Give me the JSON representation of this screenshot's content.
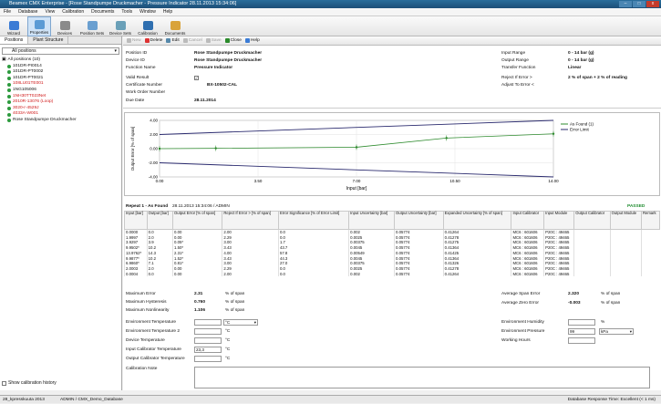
{
  "window": {
    "title": "Beamex CMX Enterprise - [Rose Standpumpe Druckmacher - Pressure Indicator 28.11.2013 15:34:06]",
    "min": "–",
    "max": "□",
    "close": "x"
  },
  "menu": [
    "File",
    "Database",
    "View",
    "Calibration",
    "Documents",
    "Tools",
    "Window",
    "Help"
  ],
  "toolbar": [
    {
      "label": "Wizard",
      "color": "#3a7bd5"
    },
    {
      "label": "Properties",
      "color": "#5b9bd5",
      "active": true
    },
    {
      "label": "Devices",
      "color": "#8a8a8a"
    },
    {
      "label": "Position Sets",
      "color": "#6a9fd0"
    },
    {
      "label": "Device Sets",
      "color": "#6aa0b8"
    },
    {
      "label": "Calibration",
      "color": "#2f6fb0"
    },
    {
      "label": "Documents",
      "color": "#d9a33a"
    }
  ],
  "left": {
    "tabs": [
      "Positions",
      "Plant Structure"
    ],
    "filter": "All positions",
    "root": "All positions (10)",
    "nodes": [
      {
        "label": "101DR-PI0014",
        "red": false
      },
      {
        "label": "101DR-PT0002",
        "red": false
      },
      {
        "label": "101DR-PT0021",
        "red": false
      },
      {
        "label": "108LU01TE001",
        "red": true
      },
      {
        "label": "1NG105006",
        "red": false
      },
      {
        "label": "1NH30TT023Net",
        "red": true
      },
      {
        "label": "2010R-13076 (Loop)",
        "red": true
      },
      {
        "label": "3020-r-4529J",
        "red": true
      },
      {
        "label": "4033A-W001",
        "red": true
      },
      {
        "label": "Rose Standpumpe Druckmacher",
        "red": false
      }
    ],
    "show_history": "Show calibration history"
  },
  "actions": [
    {
      "label": "New",
      "disabled": true
    },
    {
      "label": "Delete"
    },
    {
      "label": "Edit"
    },
    {
      "label": "Cancel",
      "disabled": true
    },
    {
      "label": "Save",
      "disabled": true
    },
    {
      "label": "Close"
    },
    {
      "label": "Help"
    }
  ],
  "info": {
    "position_id_label": "Position ID",
    "position_id": "Rose Standpumpe Druckmacher",
    "device_id_label": "Device ID",
    "device_id": "Rose Standpumpe Druckmacher",
    "function_label": "Function Name",
    "function": "Pressure Indicator",
    "valid_label": "Valid Result",
    "cert_label": "Certificate Number",
    "cert": "BX-10502-CAL",
    "wo_label": "Work Order Number",
    "due_label": "Due Date",
    "due": "28.11.2014",
    "input_range_label": "Input Range",
    "input_range": "0 - 14 bar (g)",
    "output_range_label": "Output Range",
    "output_range": "0 - 14 bar (g)",
    "transfer_label": "Transfer Function",
    "transfer": "Linear",
    "reject_label": "Reject If Error >",
    "reject": "2 % of span + 2 % of reading",
    "adjust_label": "Adjust To Error <"
  },
  "chart_data": {
    "type": "line",
    "xlabel": "Input [bar]",
    "ylabel": "Output Error [% of span]",
    "xlim": [
      0,
      14
    ],
    "ylim": [
      -4,
      4
    ],
    "x_ticks": [
      0,
      3.5,
      7,
      10.5,
      14
    ],
    "x_tick_labels": [
      "0.00",
      "3.50",
      "7.00",
      "10.50",
      "14.00"
    ],
    "y_ticks": [
      -4,
      -2,
      0,
      2,
      4
    ],
    "y_tick_labels": [
      "-4.00",
      "-2.00",
      "0.00",
      "2.00",
      "4.00"
    ],
    "legend": "top-right",
    "series": [
      {
        "name": "As Found (1)",
        "color": "#2e8b2e",
        "x": [
          0,
          2,
          7,
          10.2,
          14
        ],
        "y": [
          0,
          0.05,
          0.2,
          1.5,
          2.1
        ]
      },
      {
        "name": "Error Limit",
        "color": "#2a2a6e",
        "x": [
          0,
          14
        ],
        "y": [
          2,
          4
        ]
      },
      {
        "color": "#2a2a6e",
        "x": [
          0,
          14
        ],
        "y": [
          -2,
          -4
        ]
      }
    ]
  },
  "repeat": {
    "title": "Repeat 1 - As Found",
    "date": "28.11.2013 15:34:06 / ADMIN",
    "status": "PASSED"
  },
  "table": {
    "headers": [
      "Input [bar]",
      "Output [bar]",
      "Output Error [% of span]",
      "Reject If Error > [% of span]",
      "Error Significance [% of Error Limit]",
      "Input Uncertainty [bar]",
      "Output Uncertainty [bar]",
      "Expanded Uncertainty [% of span]",
      "Input Calibrator",
      "Input Module",
      "Output Calibrator",
      "Output Module",
      "Remark"
    ],
    "rows": [
      [
        "0.0000",
        "0.0",
        "0.00",
        "2.00",
        "0.0",
        "0.002",
        "0.05774",
        "0.41264",
        "MC6 : 601606",
        "P20C : 49465",
        "",
        "",
        ""
      ],
      [
        "1.9997",
        "2.0",
        "0.00",
        "2.29",
        "0.0",
        "0.0025",
        "0.05774",
        "0.41278",
        "MC6 : 601606",
        "P20C : 49465",
        "",
        "",
        ""
      ],
      [
        "3.9297",
        "3.9",
        "0.05*",
        "3.00",
        "1.7",
        "0.00375",
        "0.05774",
        "0.41275",
        "MC6 : 601606",
        "P20C : 49465",
        "",
        "",
        ""
      ],
      [
        "9.9502*",
        "10.2",
        "1.50*",
        "3.43",
        "43.7",
        "0.0045",
        "0.05774",
        "0.41364",
        "MC6 : 601606",
        "P20C : 49465",
        "",
        "",
        ""
      ],
      [
        "13.9762*",
        "14.3",
        "2.31*",
        "4.00",
        "57.8",
        "0.00549",
        "0.05774",
        "0.41425",
        "MC6 : 601606",
        "P20C : 49465",
        "",
        "",
        ""
      ],
      [
        "9.9877*",
        "10.2",
        "1.52*",
        "3.43",
        "44.3",
        "0.0045",
        "0.05774",
        "0.41364",
        "MC6 : 601606",
        "P20C : 49465",
        "",
        "",
        ""
      ],
      [
        "6.9860*",
        "7.1",
        "0.81*",
        "3.00",
        "27.0",
        "0.00375",
        "0.05774",
        "0.41326",
        "MC6 : 601606",
        "P20C : 49465",
        "",
        "",
        ""
      ],
      [
        "2.0003",
        "2.0",
        "0.00",
        "2.29",
        "0.0",
        "0.0025",
        "0.05774",
        "0.41278",
        "MC6 : 601606",
        "P20C : 49465",
        "",
        "",
        ""
      ],
      [
        "0.0004",
        "0.0",
        "0.00",
        "2.00",
        "0.0",
        "0.002",
        "0.05774",
        "0.41264",
        "MC6 : 601606",
        "P20C : 49465",
        "",
        "",
        ""
      ]
    ]
  },
  "summary": {
    "max_error_label": "Maximum Error",
    "max_error": "2.31",
    "unit1": "% of span",
    "max_hyst_label": "Maximum Hysteresis",
    "max_hyst": "0.760",
    "unit2": "% of span",
    "max_nonlin_label": "Maximum Nonlinearity",
    "max_nonlin": "1.106",
    "unit3": "% of span",
    "avg_span_label": "Average Span Error",
    "avg_span": "2.320",
    "unit4": "% of span",
    "avg_zero_label": "Average Zero Error",
    "avg_zero": "-0.003",
    "unit5": "% of span"
  },
  "env": {
    "temp_label": "Environment Temperature",
    "temp_unit": "°C",
    "temp2_label": "Environment Temperature 2",
    "temp2_unit": "°C",
    "dev_temp_label": "Device Temperature",
    "dev_temp_unit": "°C",
    "in_cal_temp_label": "Input Calibrator Temperature",
    "in_cal_temp": "23,3",
    "in_cal_temp_unit": "°C",
    "out_cal_temp_label": "Output Calibrator Temperature",
    "out_cal_temp_unit": "°C",
    "note_label": "Calibration Note",
    "humidity_label": "Environment Humidity",
    "humidity_unit": "%",
    "pressure_label": "Environment Pressure",
    "pressure": "99",
    "pressure_unit": "kPa",
    "hours_label": "Working Hours"
  },
  "status": {
    "left": "28_kpresskuuta 2013",
    "user": "ADMIN / CMX_Demo_Database",
    "right": "Database Response Time: Excellent (< 1 ms)"
  }
}
